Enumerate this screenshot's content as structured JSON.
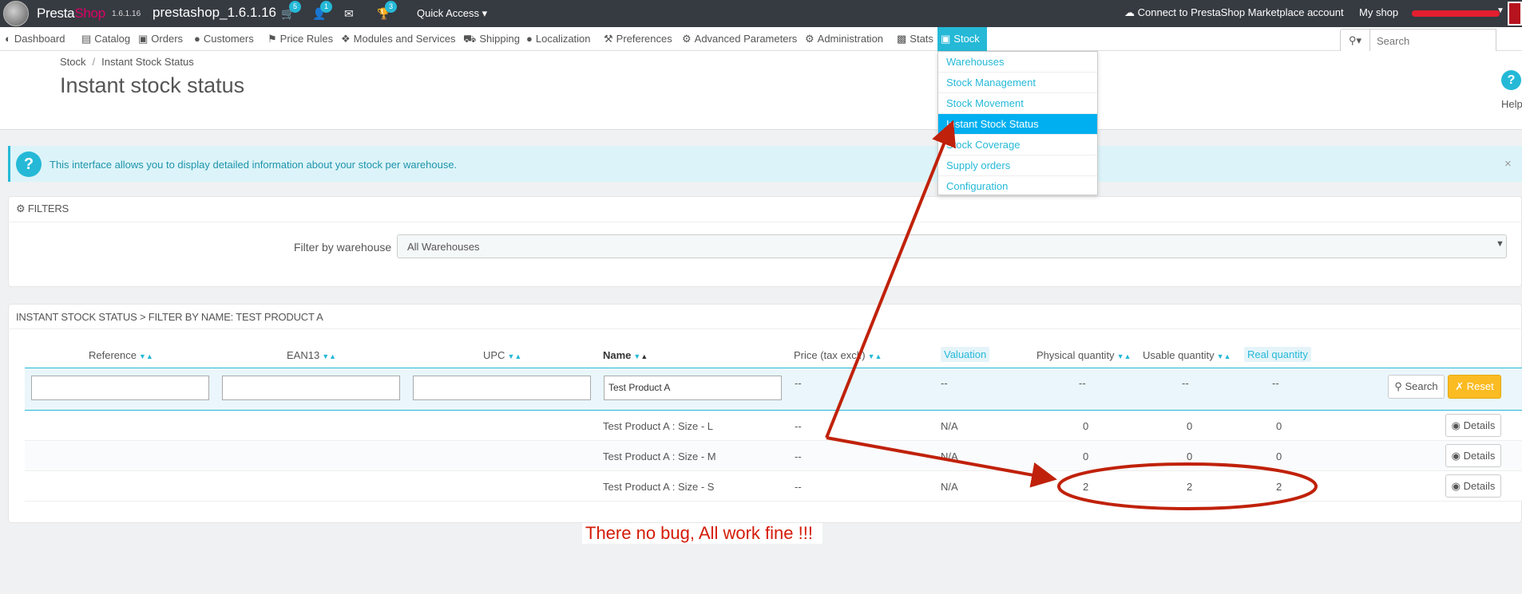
{
  "topbar": {
    "brand_presta": "Presta",
    "brand_shop": "Shop",
    "version": "1.6.1.16",
    "shop_name": "prestashop_1.6.1.16",
    "orders_badge": "5",
    "customers_badge": "1",
    "trophy_badge": "3",
    "quick_access": "Quick Access",
    "marketplace": "Connect to PrestaShop Marketplace account",
    "my_shop": "My shop"
  },
  "nav": {
    "items": [
      {
        "label": "Dashboard",
        "icon": "dashboard-icon"
      },
      {
        "label": "Catalog",
        "icon": "book-icon"
      },
      {
        "label": "Orders",
        "icon": "credit-card-icon"
      },
      {
        "label": "Customers",
        "icon": "users-icon"
      },
      {
        "label": "Price Rules",
        "icon": "tag-icon"
      },
      {
        "label": "Modules and Services",
        "icon": "puzzle-icon"
      },
      {
        "label": "Shipping",
        "icon": "truck-icon"
      },
      {
        "label": "Localization",
        "icon": "globe-icon"
      },
      {
        "label": "Preferences",
        "icon": "wrench-icon"
      },
      {
        "label": "Advanced Parameters",
        "icon": "cogs-icon"
      },
      {
        "label": "Administration",
        "icon": "gear-icon"
      },
      {
        "label": "Stats",
        "icon": "bar-chart-icon"
      },
      {
        "label": "Stock",
        "icon": "stock-icon"
      }
    ],
    "search_placeholder": "Search"
  },
  "stock_menu": [
    "Warehouses",
    "Stock Management",
    "Stock Movement",
    "Instant Stock Status",
    "Stock Coverage",
    "Supply orders",
    "Configuration"
  ],
  "page": {
    "breadcrumb_parent": "Stock",
    "breadcrumb_current": "Instant Stock Status",
    "title": "Instant stock status",
    "help": "Help"
  },
  "alert": {
    "text": "This interface allows you to display detailed information about your stock per warehouse."
  },
  "filters": {
    "heading": "FILTERS",
    "warehouse_label": "Filter by warehouse",
    "warehouse_value": "All Warehouses"
  },
  "table": {
    "heading": "INSTANT STOCK STATUS > FILTER BY NAME: TEST PRODUCT A",
    "columns": {
      "reference": "Reference",
      "ean13": "EAN13",
      "upc": "UPC",
      "name": "Name",
      "price": "Price (tax excl.)",
      "valuation": "Valuation",
      "physical": "Physical quantity",
      "usable": "Usable quantity",
      "real": "Real quantity"
    },
    "filter_name_value": "Test Product A",
    "dash": "--",
    "search_button": "Search",
    "reset_button": "Reset",
    "rows": [
      {
        "name": "Test Product A : Size - L",
        "price": "--",
        "valuation": "N/A",
        "physical": "0",
        "usable": "0",
        "real": "0"
      },
      {
        "name": "Test Product A : Size - M",
        "price": "--",
        "valuation": "N/A",
        "physical": "0",
        "usable": "0",
        "real": "0"
      },
      {
        "name": "Test Product A : Size - S",
        "price": "--",
        "valuation": "N/A",
        "physical": "2",
        "usable": "2",
        "real": "2"
      }
    ],
    "details_button": "Details"
  },
  "annotation": {
    "text": "There no bug, All work fine !!!",
    "color": "#d41b07"
  }
}
